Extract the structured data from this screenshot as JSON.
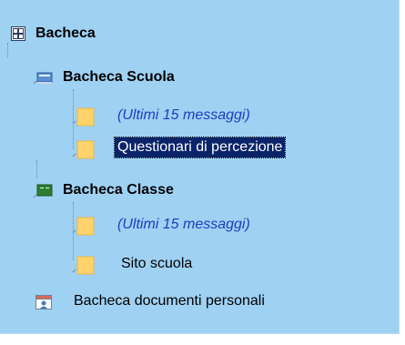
{
  "tree": {
    "root": {
      "label": "Bacheca",
      "icon": "grid-toggle-icon"
    },
    "school_board": {
      "label": "Bacheca Scuola",
      "icon": "school-board-icon",
      "items": [
        {
          "label": "(Ultimi 15 messaggi)",
          "icon": "folder-icon",
          "style": "italic-link"
        },
        {
          "label": "Questionari di percezione",
          "icon": "folder-icon",
          "style": "selected"
        }
      ]
    },
    "class_board": {
      "label": "Bacheca Classe",
      "icon": "class-board-icon",
      "items": [
        {
          "label": "(Ultimi 15 messaggi)",
          "icon": "folder-icon",
          "style": "italic-link"
        },
        {
          "label": "Sito scuola",
          "icon": "folder-icon",
          "style": "normal"
        }
      ]
    },
    "personal_docs": {
      "label": "Bacheca documenti personali",
      "icon": "personal-documents-icon"
    }
  },
  "colors": {
    "panel_background": "#9fd1f3",
    "link_text": "#1e3dbe",
    "selection_background": "#0a246a",
    "folder_fill": "#ffd36a"
  }
}
